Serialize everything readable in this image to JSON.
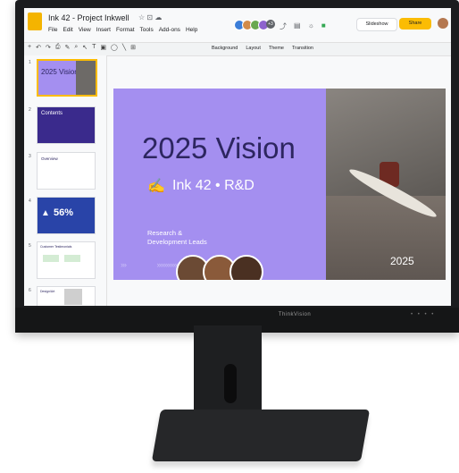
{
  "window": {
    "doc_title": "Ink 42 - Project Inkwell",
    "title_icons": "☆ ⊡ ☁",
    "menu": [
      "File",
      "Edit",
      "View",
      "Insert",
      "Format",
      "Tools",
      "Add-ons",
      "Help"
    ],
    "collaborator_count": "+3",
    "slideshow_label": "Slideshow",
    "share_label": "Share"
  },
  "toolbar": {
    "background_label": "Background",
    "layout_label": "Layout",
    "theme_label": "Theme",
    "transition_label": "Transition"
  },
  "filmstrip": {
    "numbers": [
      "1",
      "2",
      "3",
      "4",
      "5",
      "6"
    ],
    "slide1_title": "2025 Vision",
    "slide2_title": "Contents",
    "slide3_title": "Overview",
    "slide4_value": "56%",
    "slide5_title": "Customer Testimonials",
    "slide6_title": "Design/Art"
  },
  "slide": {
    "title": "2025 Vision",
    "subtitle": "Ink 42 • R&D",
    "lead_line1": "Research &",
    "lead_line2": "Development Leads",
    "year": "2025"
  },
  "monitor": {
    "brand": "ThinkVision"
  },
  "colors": {
    "slide_purple": "#a48ff0",
    "title_navy": "#2d2660",
    "share_yellow": "#fbbc04",
    "thumb_blue": "#2944a8"
  }
}
